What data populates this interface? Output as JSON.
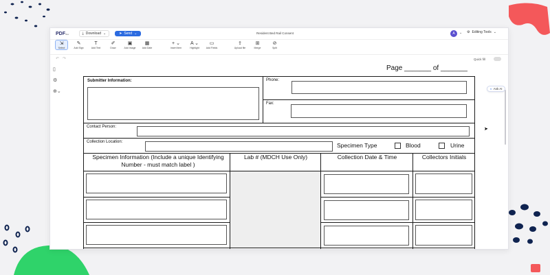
{
  "app": {
    "logo": "PDF",
    "logo_sub": "filler",
    "download_label": "Download",
    "send_label": "Send",
    "document_title": "Resident Bed Rail Consent",
    "avatar_initial": "A",
    "editing_tools_label": "Editing Tools",
    "quick_fill_label": "Quick fill",
    "ask_ai_label": "Ask AI"
  },
  "toolbar": {
    "items": [
      {
        "label": "Select",
        "icon": "select-icon",
        "glyph": "⇲"
      },
      {
        "label": "Add Sign",
        "icon": "sign-icon",
        "glyph": "✎"
      },
      {
        "label": "Add Text",
        "icon": "text-icon",
        "glyph": "T"
      },
      {
        "label": "Draw",
        "icon": "draw-icon",
        "glyph": "✐"
      },
      {
        "label": "Add Image",
        "icon": "image-icon",
        "glyph": "▣"
      },
      {
        "label": "Add Date",
        "icon": "calendar-icon",
        "glyph": "▦"
      },
      {
        "label": "Insert item",
        "icon": "plus-icon",
        "glyph": "+"
      },
      {
        "label": "Highlight",
        "icon": "highlight-icon",
        "glyph": "A"
      },
      {
        "label": "Add Fields",
        "icon": "fields-icon",
        "glyph": "▭"
      },
      {
        "label": "Upload file",
        "icon": "upload-icon",
        "glyph": "⇪"
      },
      {
        "label": "Merge",
        "icon": "merge-icon",
        "glyph": "⊞"
      },
      {
        "label": "Split",
        "icon": "split-icon",
        "glyph": "⊘"
      }
    ]
  },
  "form": {
    "page_label": "Page _______ of _______",
    "submitter_label": "Submitter Information:",
    "phone_label": "Phone:",
    "fax_label": "Fax:",
    "contact_label": "Contact Person:",
    "location_label": "Collection Location:",
    "specimen_type_label": "Specimen Type",
    "blood_label": "Blood",
    "urine_label": "Urine",
    "col1_header": "Specimen Information (Include a unique Identifying Number -  must match label )",
    "col2_header": "Lab # (MDCH Use Only)",
    "col3_header": "Collection Date & Time",
    "col4_header": "Collectors Initials"
  },
  "colors": {
    "accent": "#2c6be0",
    "deco_red": "#f4585a",
    "deco_green": "#2fd36a",
    "deco_navy": "#0f2350"
  }
}
